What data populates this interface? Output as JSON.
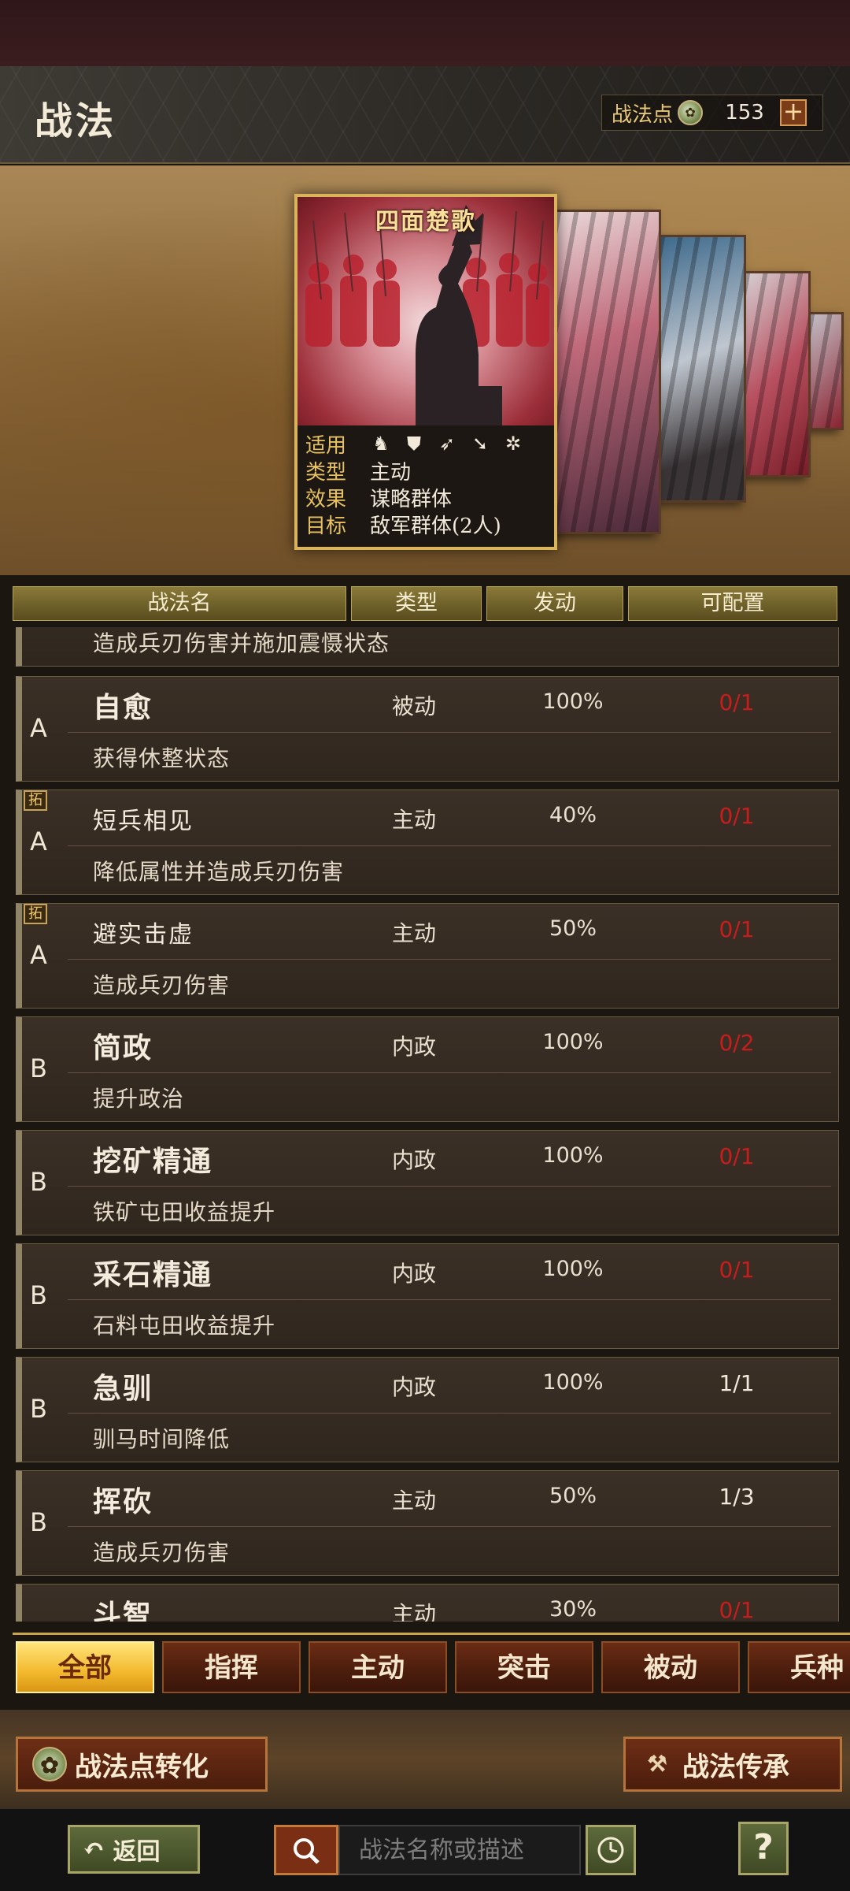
{
  "header": {
    "title": "战法",
    "points_label": "战法点",
    "points_value": "153",
    "plus": "+"
  },
  "featured_card": {
    "name": "四面楚歌",
    "rows": [
      {
        "key": "适用",
        "value": ""
      },
      {
        "key": "类型",
        "value": "主动"
      },
      {
        "key": "效果",
        "value": "谋略群体"
      },
      {
        "key": "目标",
        "value": "敌军群体(2人)"
      }
    ],
    "troop_icons": [
      "cavalry-icon",
      "shield-icon",
      "bow-icon",
      "spear-icon",
      "wheel-icon"
    ]
  },
  "table": {
    "headers": [
      "战法名",
      "类型",
      "发动",
      "可配置"
    ]
  },
  "partial_top_desc": "造成兵刃伤害并施加震慑状态",
  "rows": [
    {
      "grade": "A",
      "tag": "",
      "name": "自愈",
      "type": "被动",
      "rate": "100%",
      "config": "0/1",
      "config_red": true,
      "desc": "获得休整状态",
      "small": false
    },
    {
      "grade": "A",
      "tag": "拓",
      "name": "短兵相见",
      "type": "主动",
      "rate": "40%",
      "config": "0/1",
      "config_red": true,
      "desc": "降低属性并造成兵刃伤害",
      "small": true
    },
    {
      "grade": "A",
      "tag": "拓",
      "name": "避实击虚",
      "type": "主动",
      "rate": "50%",
      "config": "0/1",
      "config_red": true,
      "desc": "造成兵刃伤害",
      "small": true
    },
    {
      "grade": "B",
      "tag": "",
      "name": "简政",
      "type": "内政",
      "rate": "100%",
      "config": "0/2",
      "config_red": true,
      "desc": "提升政治",
      "small": false
    },
    {
      "grade": "B",
      "tag": "",
      "name": "挖矿精通",
      "type": "内政",
      "rate": "100%",
      "config": "0/1",
      "config_red": true,
      "desc": "铁矿屯田收益提升",
      "small": false
    },
    {
      "grade": "B",
      "tag": "",
      "name": "采石精通",
      "type": "内政",
      "rate": "100%",
      "config": "0/1",
      "config_red": true,
      "desc": "石料屯田收益提升",
      "small": false
    },
    {
      "grade": "B",
      "tag": "",
      "name": "急驯",
      "type": "内政",
      "rate": "100%",
      "config": "1/1",
      "config_red": false,
      "desc": "驯马时间降低",
      "small": false
    },
    {
      "grade": "B",
      "tag": "",
      "name": "挥砍",
      "type": "主动",
      "rate": "50%",
      "config": "1/3",
      "config_red": false,
      "desc": "造成兵刃伤害",
      "small": false
    },
    {
      "grade": "",
      "tag": "",
      "name": "斗智",
      "type": "主动",
      "rate": "30%",
      "config": "0/1",
      "config_red": true,
      "desc": "",
      "small": false
    }
  ],
  "tabs": [
    {
      "label": "全部",
      "active": true
    },
    {
      "label": "指挥",
      "active": false
    },
    {
      "label": "主动",
      "active": false
    },
    {
      "label": "突击",
      "active": false
    },
    {
      "label": "被动",
      "active": false
    },
    {
      "label": "兵种",
      "active": false
    }
  ],
  "actions": {
    "convert": "战法点转化",
    "inherit": "战法传承"
  },
  "bottom": {
    "back": "返回",
    "search_placeholder": "战法名称或描述",
    "help": "?"
  },
  "colors": {
    "accent_gold": "#d9b45a",
    "config_red": "#c71d1d",
    "tab_active": "#f3b92d"
  }
}
